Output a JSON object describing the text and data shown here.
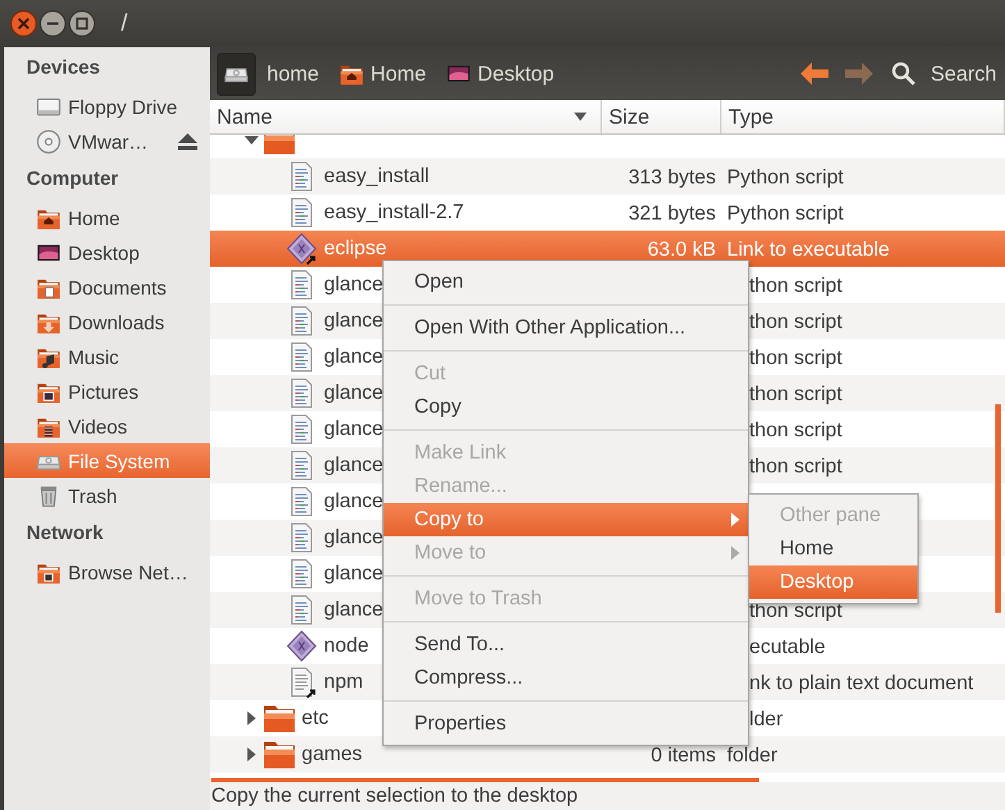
{
  "window": {
    "title": "/"
  },
  "sidebar": {
    "sections": [
      {
        "heading": "Devices",
        "items": [
          {
            "label": "Floppy Drive",
            "kind": "floppy",
            "selected": false,
            "eject": false
          },
          {
            "label": "VMwar…",
            "kind": "disc",
            "selected": false,
            "eject": true
          }
        ]
      },
      {
        "heading": "Computer",
        "items": [
          {
            "label": "Home",
            "kind": "home",
            "selected": false,
            "eject": false
          },
          {
            "label": "Desktop",
            "kind": "desktop",
            "selected": false,
            "eject": false
          },
          {
            "label": "Documents",
            "kind": "documents",
            "selected": false,
            "eject": false
          },
          {
            "label": "Downloads",
            "kind": "downloads",
            "selected": false,
            "eject": false
          },
          {
            "label": "Music",
            "kind": "music",
            "selected": false,
            "eject": false
          },
          {
            "label": "Pictures",
            "kind": "pictures",
            "selected": false,
            "eject": false
          },
          {
            "label": "Videos",
            "kind": "videos",
            "selected": false,
            "eject": false
          },
          {
            "label": "File System",
            "kind": "drive",
            "selected": true,
            "eject": false
          },
          {
            "label": "Trash",
            "kind": "trash",
            "selected": false,
            "eject": false
          }
        ]
      },
      {
        "heading": "Network",
        "items": [
          {
            "label": "Browse Net…",
            "kind": "network",
            "selected": false,
            "eject": false
          }
        ]
      }
    ]
  },
  "toolbar": {
    "path": [
      {
        "kind": "drive",
        "selected": true
      },
      {
        "kind": "text",
        "label": "home",
        "selected": false
      },
      {
        "kind": "home",
        "label": "Home",
        "selected": false
      },
      {
        "kind": "desktop",
        "label": "Desktop",
        "selected": false
      }
    ],
    "back": {
      "disabled": false
    },
    "forward": {
      "disabled": true
    },
    "search": "Search"
  },
  "table": {
    "columns": [
      {
        "label": "Name",
        "sort_indicator": true
      },
      {
        "label": "Size",
        "sort_indicator": false
      },
      {
        "label": "Type",
        "sort_indicator": false
      }
    ],
    "rows": [
      {
        "kind": "folder",
        "selected": false,
        "expanded": true,
        "children": [
          {
            "name": "easy_install",
            "size": "313 bytes",
            "type": "Python script",
            "kind": "script",
            "selected": false
          },
          {
            "name": "easy_install-2.7",
            "size": "321 bytes",
            "type": "Python script",
            "kind": "script",
            "selected": false
          },
          {
            "name": "eclipse",
            "size": "63.0 kB",
            "type": "Link to executable",
            "kind": "executable-link",
            "selected": true
          },
          {
            "name": "glance",
            "type": "thon script",
            "type_cut": true,
            "kind": "script",
            "selected": false
          },
          {
            "name": "glance",
            "type": "thon script",
            "type_cut": true,
            "kind": "script",
            "selected": false
          },
          {
            "name": "glance",
            "type": "thon script",
            "type_cut": true,
            "kind": "script",
            "selected": false
          },
          {
            "name": "glance",
            "type": "thon script",
            "type_cut": true,
            "kind": "script",
            "selected": false
          },
          {
            "name": "glance",
            "type": "thon script",
            "type_cut": true,
            "kind": "script",
            "selected": false
          },
          {
            "name": "glance",
            "type": "thon script",
            "type_cut": true,
            "kind": "script",
            "selected": false
          },
          {
            "name": "glance",
            "kind": "script",
            "selected": false
          },
          {
            "name": "glance",
            "kind": "script",
            "selected": false
          },
          {
            "name": "glance",
            "kind": "script",
            "selected": false
          },
          {
            "name": "glance",
            "type": "thon script",
            "type_cut": true,
            "kind": "script",
            "selected": false
          },
          {
            "name": "node",
            "type": "ecutable",
            "type_cut": true,
            "kind": "executable",
            "selected": false
          },
          {
            "name": "npm",
            "type": "nk to plain text document",
            "type_cut": true,
            "kind": "text-link",
            "selected": false
          }
        ]
      },
      {
        "name": "etc",
        "type": "lder",
        "type_cut": true,
        "kind": "folder",
        "selected": false,
        "expanded": false
      },
      {
        "name": "games",
        "size": "0 items",
        "type": "folder",
        "kind": "folder",
        "selected": false,
        "expanded": false
      }
    ]
  },
  "context_menu": {
    "items": [
      {
        "kind": "item",
        "label": "Open",
        "disabled": false,
        "selected": false,
        "submenu": false
      },
      {
        "kind": "separator"
      },
      {
        "kind": "item",
        "label": "Open With Other Application...",
        "disabled": false,
        "selected": false,
        "submenu": false
      },
      {
        "kind": "separator"
      },
      {
        "kind": "item",
        "label": "Cut",
        "disabled": true,
        "selected": false,
        "submenu": false
      },
      {
        "kind": "item",
        "label": "Copy",
        "disabled": false,
        "selected": false,
        "submenu": false
      },
      {
        "kind": "separator"
      },
      {
        "kind": "item",
        "label": "Make Link",
        "disabled": true,
        "selected": false,
        "submenu": false
      },
      {
        "kind": "item",
        "label": "Rename...",
        "disabled": true,
        "selected": false,
        "submenu": false
      },
      {
        "kind": "item",
        "label": "Copy to",
        "disabled": false,
        "selected": true,
        "submenu": true
      },
      {
        "kind": "item",
        "label": "Move to",
        "disabled": true,
        "selected": false,
        "submenu": true
      },
      {
        "kind": "separator"
      },
      {
        "kind": "item",
        "label": "Move to Trash",
        "disabled": true,
        "selected": false,
        "submenu": false
      },
      {
        "kind": "separator"
      },
      {
        "kind": "item",
        "label": "Send To...",
        "disabled": false,
        "selected": false,
        "submenu": false
      },
      {
        "kind": "item",
        "label": "Compress...",
        "disabled": false,
        "selected": false,
        "submenu": false
      },
      {
        "kind": "separator"
      },
      {
        "kind": "item",
        "label": "Properties",
        "disabled": false,
        "selected": false,
        "submenu": false
      }
    ]
  },
  "submenu": {
    "items": [
      {
        "label": "Other pane",
        "disabled": true,
        "selected": false
      },
      {
        "label": "Home",
        "disabled": false,
        "selected": false
      },
      {
        "label": "Desktop",
        "disabled": false,
        "selected": true
      }
    ]
  },
  "status_bar": {
    "text": "Copy the current selection to the desktop"
  }
}
